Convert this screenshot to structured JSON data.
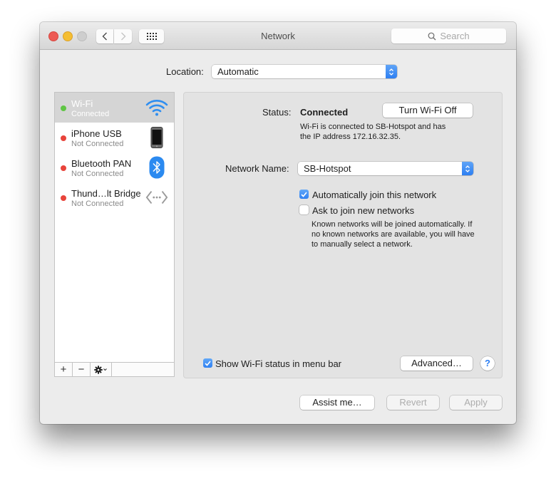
{
  "window": {
    "title": "Network",
    "search_placeholder": "Search"
  },
  "location": {
    "label": "Location:",
    "value": "Automatic"
  },
  "services": [
    {
      "name": "Wi-Fi",
      "state": "Connected",
      "status_color": "#5fc544",
      "icon": "wifi-icon",
      "selected": true
    },
    {
      "name": "iPhone USB",
      "state": "Not Connected",
      "status_color": "#e8443b",
      "icon": "iphone-icon",
      "selected": false
    },
    {
      "name": "Bluetooth PAN",
      "state": "Not Connected",
      "status_color": "#e8443b",
      "icon": "bluetooth-icon",
      "selected": false
    },
    {
      "name": "Thund…lt Bridge",
      "state": "Not Connected",
      "status_color": "#e8443b",
      "icon": "thunderbolt-bridge-icon",
      "selected": false
    }
  ],
  "sidebar_tools": {
    "add": "+",
    "remove": "−",
    "gear": "gear-icon"
  },
  "detail": {
    "status_label": "Status:",
    "status_value": "Connected",
    "turn_off_button": "Turn Wi-Fi Off",
    "status_desc_line1": "Wi-Fi is connected to SB-Hotspot and has",
    "status_desc_line2": "the IP address 172.16.32.35.",
    "network_name_label": "Network Name:",
    "network_name_value": "SB-Hotspot",
    "auto_join_label": "Automatically join this network",
    "auto_join_checked": true,
    "ask_join_label": "Ask to join new networks",
    "ask_join_checked": false,
    "ask_desc_line1": "Known networks will be joined automatically. If",
    "ask_desc_line2": "no known networks are available, you will have",
    "ask_desc_line3": "to manually select a network.",
    "show_status_label": "Show Wi-Fi status in menu bar",
    "show_status_checked": true,
    "advanced_button": "Advanced…",
    "help_button": "?"
  },
  "footer": {
    "assist_button": "Assist me…",
    "revert_button": "Revert",
    "apply_button": "Apply"
  },
  "colors": {
    "accent": "#2d7ff2",
    "connected": "#5fc544",
    "disconnected": "#e8443b"
  }
}
